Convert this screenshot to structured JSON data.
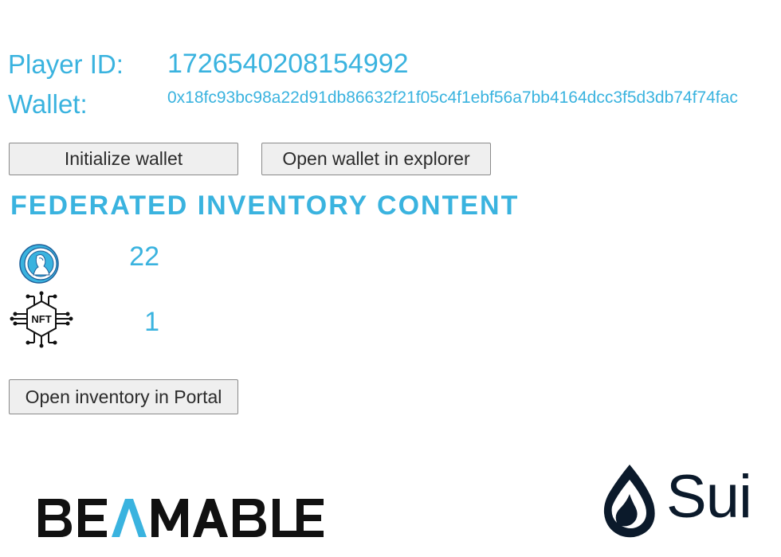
{
  "player": {
    "id_label": "Player ID:",
    "id_value": "1726540208154992",
    "wallet_label": "Wallet:",
    "wallet_value": "0x18fc93bc98a22d91db86632f21f05c4f1ebf56a7bb4164dcc3f5d3db74f74fac"
  },
  "buttons": {
    "initialize_wallet": "Initialize wallet",
    "open_wallet_explorer": "Open wallet in explorer",
    "open_inventory_portal": "Open inventory in Portal"
  },
  "inventory": {
    "heading": "FEDERATED INVENTORY CONTENT",
    "items": [
      {
        "icon": "coin-icon",
        "count": "22"
      },
      {
        "icon": "nft-chip-icon",
        "icon_text": "NFT",
        "count": "1"
      }
    ]
  },
  "logos": {
    "beamable": "BEAMABLE",
    "sui": "Sui"
  },
  "colors": {
    "accent": "#3ab3df",
    "logo_dark": "#0b1a2b",
    "button_bg": "#efefef",
    "button_border": "#8a8a8a"
  }
}
